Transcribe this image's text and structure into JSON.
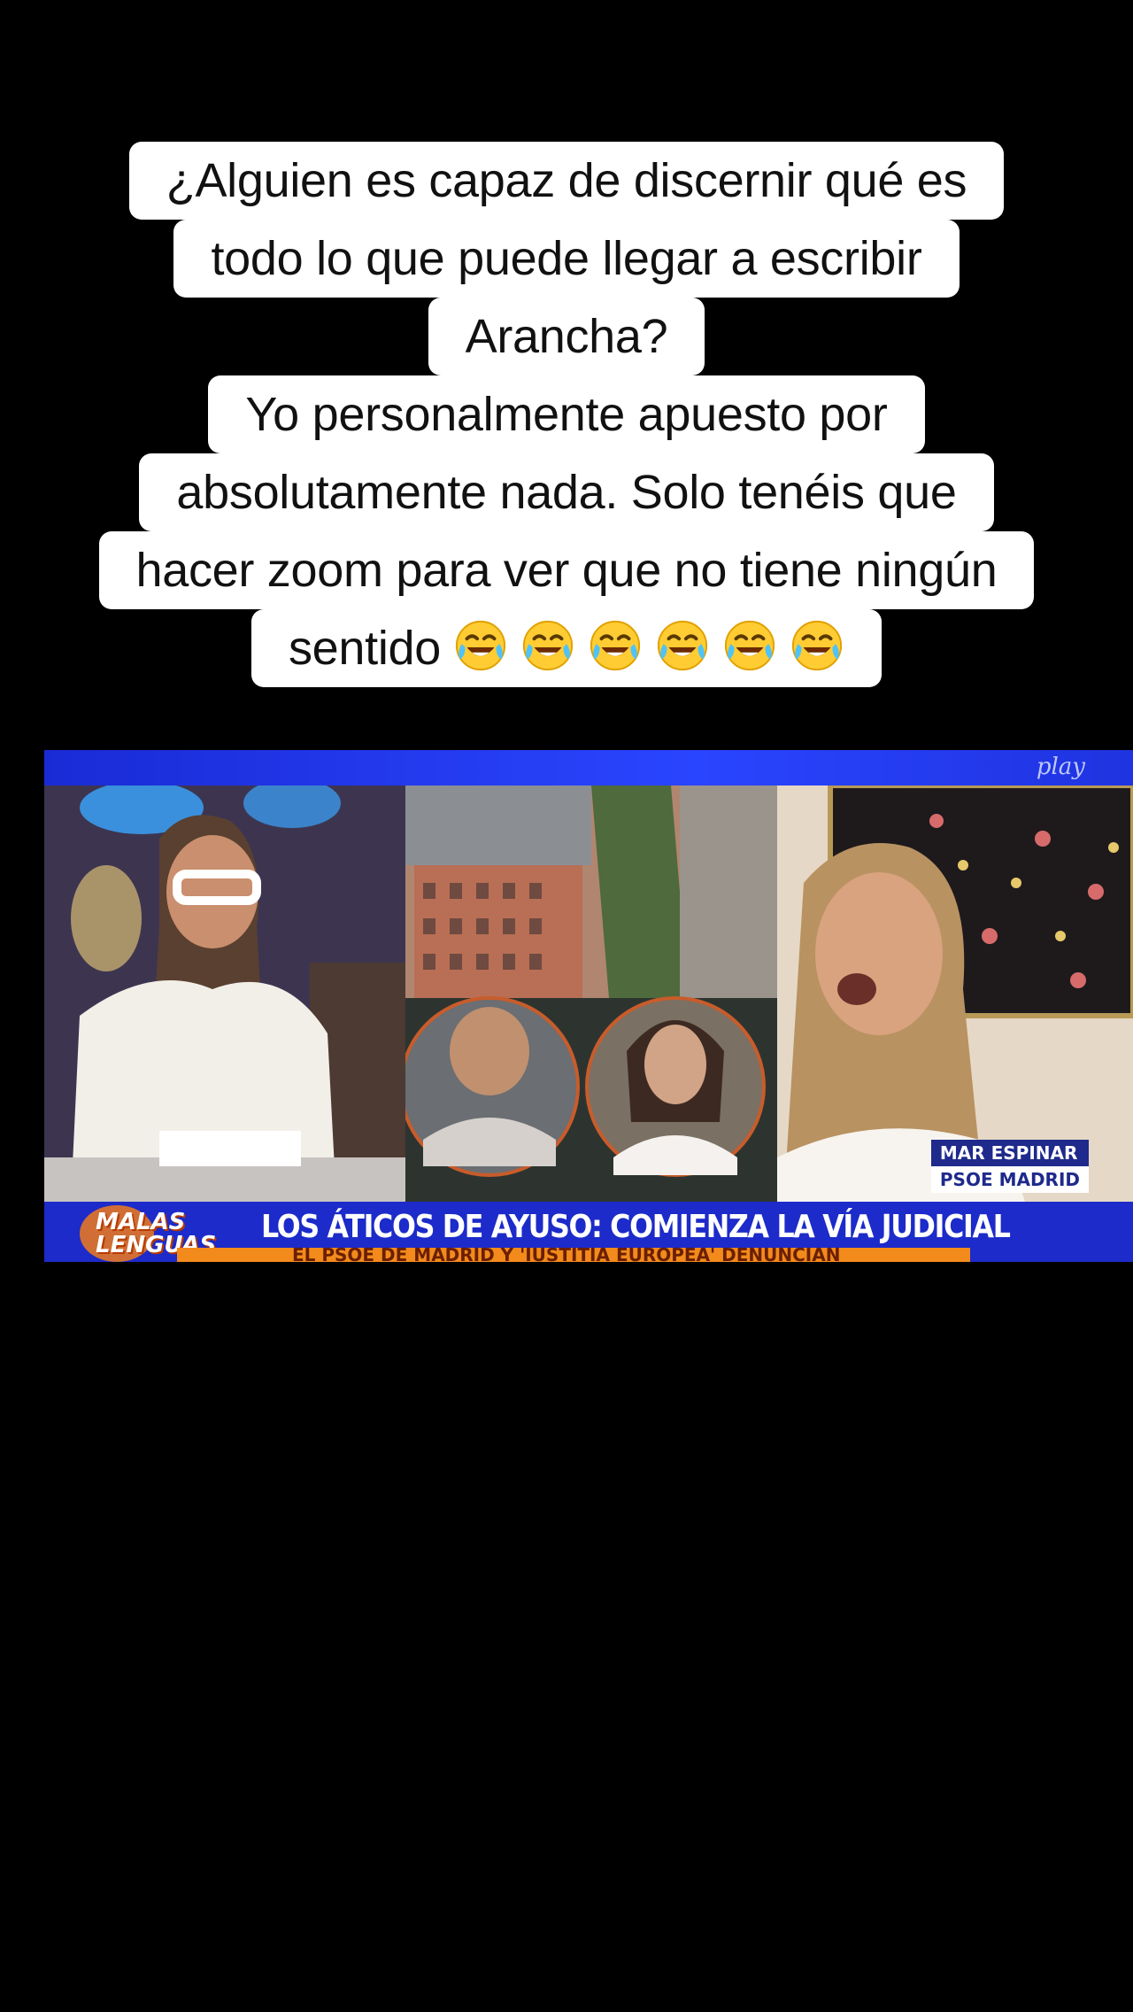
{
  "caption": {
    "lines": [
      "¿Alguien es capaz de discernir qué es",
      "todo lo que puede llegar a escribir",
      "Arancha?",
      "Yo personalmente apuesto por",
      "absolutamente nada. Solo tenéis que",
      "hacer zoom para ver que no tiene ningún",
      "sentido"
    ],
    "emoji": "rolling-on-floor-laughing-emoji",
    "emoji_count": 6
  },
  "video": {
    "brand": "play",
    "show_logo": [
      "MALAS",
      "LENGUAS"
    ],
    "headline": "LOS ÁTICOS DE AYUSO: COMIENZA LA VÍA JUDICIAL",
    "subline": "EL PSOE DE MADRID Y 'IUSTITIA EUROPEA' DENUNCIAN",
    "guest_name": "MAR ESPINAR",
    "guest_party": "PSOE MADRID"
  }
}
